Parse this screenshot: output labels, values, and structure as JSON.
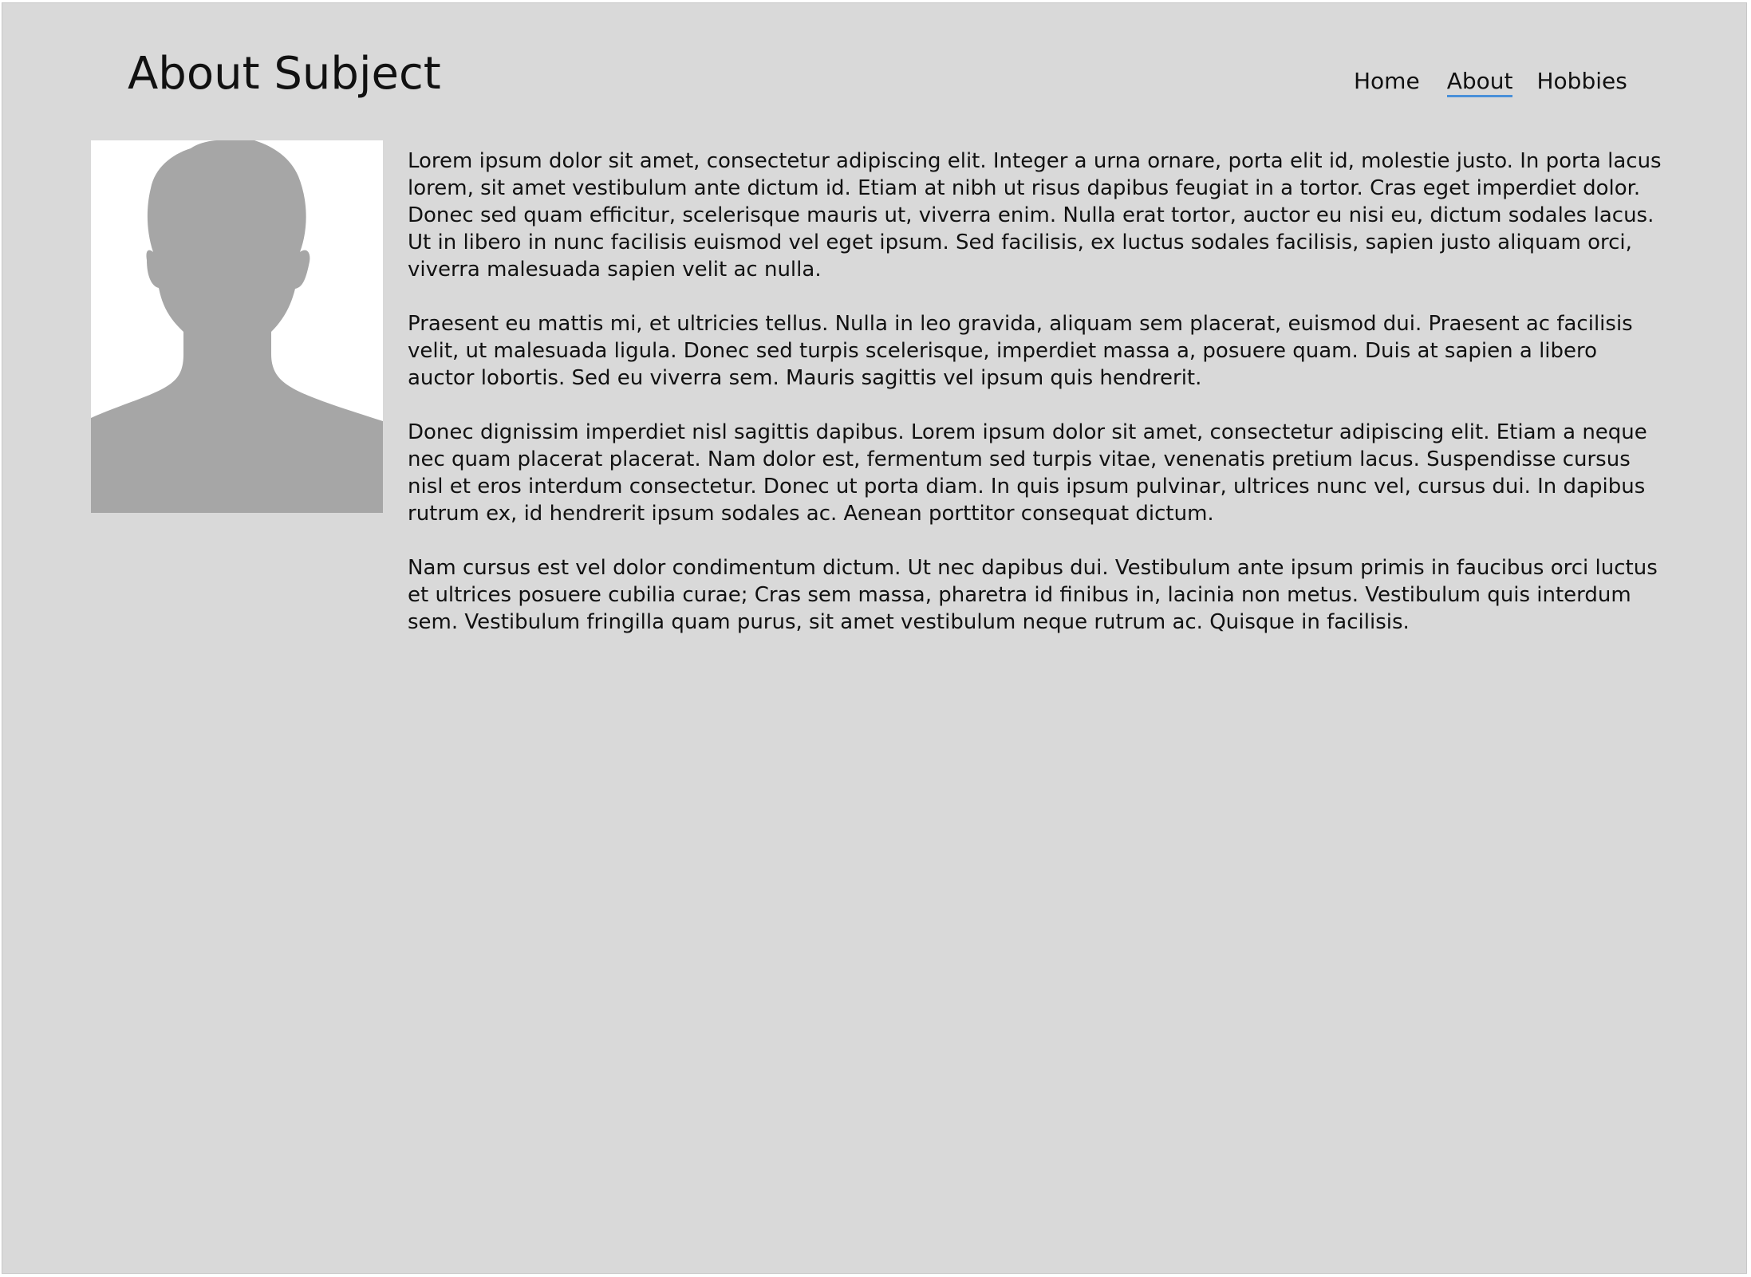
{
  "header": {
    "title": "About Subject"
  },
  "nav": {
    "items": [
      {
        "label": "Home",
        "active": false
      },
      {
        "label": "About",
        "active": true
      },
      {
        "label": "Hobbies",
        "active": false
      }
    ],
    "active_underline_color": "#4a90d9"
  },
  "profile": {
    "avatar_icon": "person-silhouette-icon"
  },
  "main": {
    "paragraphs": [
      "Lorem ipsum dolor sit amet, consectetur adipiscing elit. Integer a urna ornare, porta elit id, molestie justo. In porta lacus lorem, sit amet vestibulum ante dictum id. Etiam at nibh ut risus dapibus feugiat in a tortor. Cras eget imperdiet dolor. Donec sed quam efficitur, scelerisque mauris ut, viverra enim. Nulla erat tortor, auctor eu nisi eu, dictum sodales lacus. Ut in libero in nunc facilisis euismod vel eget ipsum. Sed facilisis, ex luctus sodales facilisis, sapien justo aliquam orci, viverra malesuada sapien velit ac nulla.",
      "Praesent eu mattis mi, et ultricies tellus. Nulla in leo gravida, aliquam sem placerat, euismod dui. Praesent ac facilisis velit, ut malesuada ligula. Donec sed turpis scelerisque, imperdiet massa a, posuere quam. Duis at sapien a libero auctor lobortis. Sed eu viverra sem. Mauris sagittis vel ipsum quis hendrerit.",
      "Donec dignissim imperdiet nisl sagittis dapibus. Lorem ipsum dolor sit amet, consectetur adipiscing elit. Etiam a neque nec quam placerat placerat. Nam dolor est, fermentum sed turpis vitae, venenatis pretium lacus. Suspendisse cursus nisl et eros interdum consectetur. Donec ut porta diam. In quis ipsum pulvinar, ultrices nunc vel, cursus dui. In dapibus rutrum ex, id hendrerit ipsum sodales ac. Aenean porttitor consequat dictum.",
      "Nam cursus est vel dolor condimentum dictum. Ut nec dapibus dui. Vestibulum ante ipsum primis in faucibus orci luctus et ultrices posuere cubilia curae; Cras sem massa, pharetra id finibus in, lacinia non metus. Vestibulum quis interdum sem. Vestibulum fringilla quam purus, sit amet vestibulum neque rutrum ac. Quisque in facilisis."
    ]
  },
  "colors": {
    "background": "#d9d9d9",
    "text": "#111111",
    "silhouette": "#a6a6a6",
    "avatar_background": "#ffffff"
  }
}
